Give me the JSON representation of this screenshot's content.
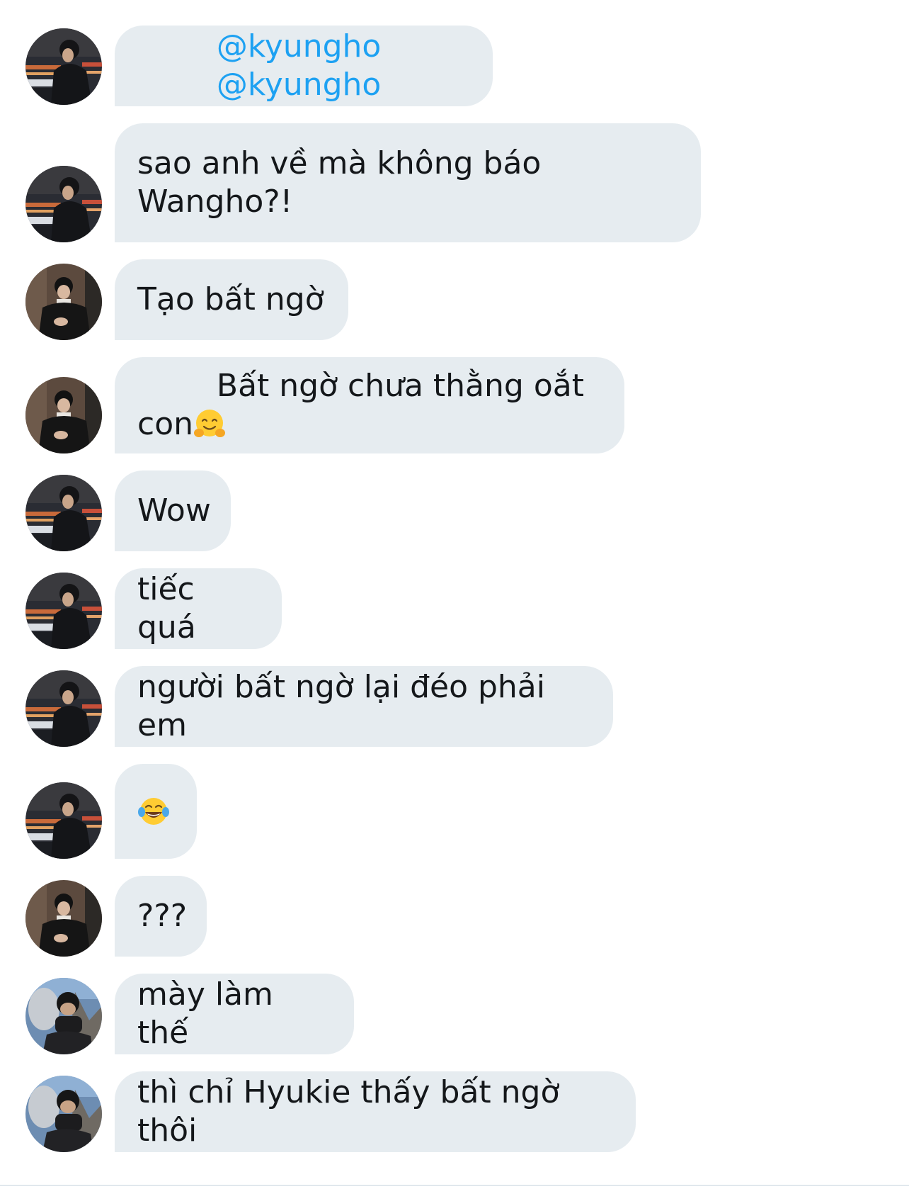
{
  "messages": [
    {
      "avatar": "avatar-a",
      "text_1": "@kyungho",
      "text_2": "@kyungho"
    },
    {
      "avatar": "avatar-a",
      "text": "sao anh về mà không báo\nWangho?!"
    },
    {
      "avatar": "avatar-b",
      "text": "Tạo bất ngờ"
    },
    {
      "avatar": "avatar-b",
      "text": "Bất ngờ chưa thằng oắt con",
      "emoji": "hugging-face-emoji"
    },
    {
      "avatar": "avatar-a",
      "text": "Wow"
    },
    {
      "avatar": "avatar-a",
      "text": "tiếc quá"
    },
    {
      "avatar": "avatar-a",
      "text": "người bất ngờ lại đéo phải em"
    },
    {
      "avatar": "avatar-a",
      "emoji": "tears-of-joy-emoji"
    },
    {
      "avatar": "avatar-b",
      "text": "???"
    },
    {
      "avatar": "avatar-c",
      "text": "mày làm thế"
    },
    {
      "avatar": "avatar-c",
      "text": "thì chỉ Hyukie thấy bất ngờ thôi"
    }
  ],
  "colors": {
    "bubble_bg": "#e6ecf0",
    "text": "#14171a",
    "mention": "#1da1f2"
  }
}
